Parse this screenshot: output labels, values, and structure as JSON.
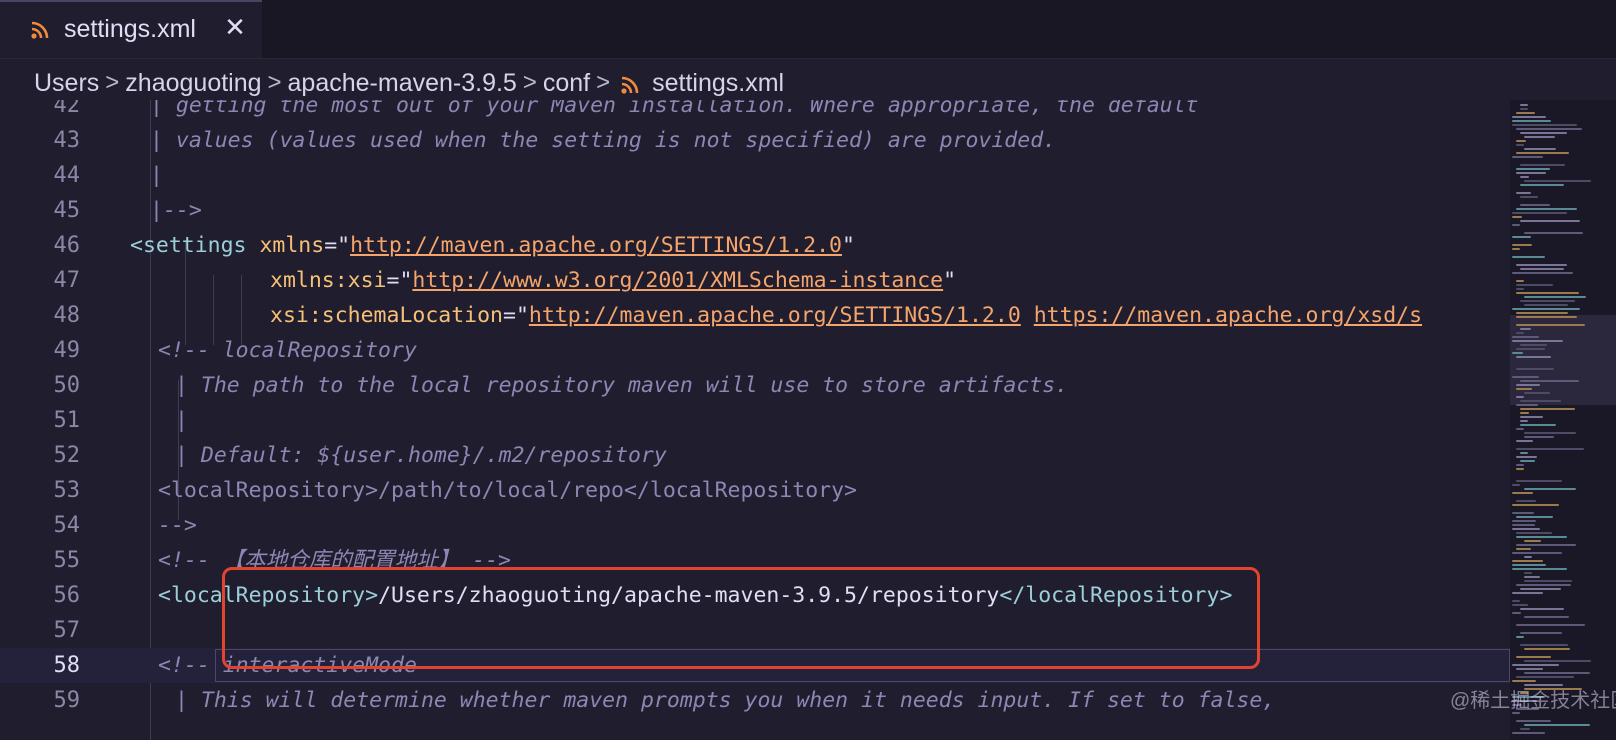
{
  "tab": {
    "label": "settings.xml",
    "icon": "rss-xml-icon",
    "close": "✕"
  },
  "breadcrumb": {
    "items": [
      "Users",
      "zhaoguoting",
      "apache-maven-3.9.5",
      "conf",
      "settings.xml"
    ],
    "separator": ">"
  },
  "editor": {
    "current_line": "58",
    "lines": [
      {
        "n": "42",
        "text": "| getting the most out of your Maven installation. Where appropriate, the default"
      },
      {
        "n": "43",
        "text": "| values (values used when the setting is not specified) are provided."
      },
      {
        "n": "44",
        "text": "|"
      },
      {
        "n": "45",
        "text": "|-->"
      },
      {
        "n": "46",
        "open": "<settings",
        "attr": "xmlns",
        "eq": "=\"",
        "url": "http://maven.apache.org/SETTINGS/1.2.0",
        "close": "\""
      },
      {
        "n": "47",
        "attr": "xmlns:xsi",
        "eq": "=\"",
        "url": "http://www.w3.org/2001/XMLSchema-instance",
        "close": "\""
      },
      {
        "n": "48",
        "attr": "xsi:schemaLocation",
        "eq": "=\"",
        "url": "http://maven.apache.org/SETTINGS/1.2.0",
        "url2": "https://maven.apache.org/xsd/s"
      },
      {
        "n": "49",
        "text": "<!-- localRepository"
      },
      {
        "n": "50",
        "text": "| The path to the local repository maven will use to store artifacts."
      },
      {
        "n": "51",
        "text": "|"
      },
      {
        "n": "52",
        "text": "| Default: ${user.home}/.m2/repository"
      },
      {
        "n": "53",
        "text": "<localRepository>/path/to/local/repo</localRepository>"
      },
      {
        "n": "54",
        "text": "-->"
      },
      {
        "n": "55",
        "text": "<!-- 【本地仓库的配置地址】 -->"
      },
      {
        "n": "56",
        "open": "<localRepository>",
        "value": "/Users/zhaoguoting/apache-maven-3.9.5/repository",
        "close": "</localRepository>"
      },
      {
        "n": "57",
        "text": ""
      },
      {
        "n": "58",
        "text": "<!-- interactiveMode"
      },
      {
        "n": "59",
        "text": "| This will determine whether maven prompts you when it needs input. If set to false,"
      }
    ]
  },
  "watermark": "@稀土掘金技术社区",
  "colors": {
    "background": "#1f1d2e",
    "comment": "#8c87b3",
    "tag": "#9ccfd8",
    "attribute": "#f6c177",
    "string": "#f5a56b",
    "highlight_border": "#e2442f"
  }
}
